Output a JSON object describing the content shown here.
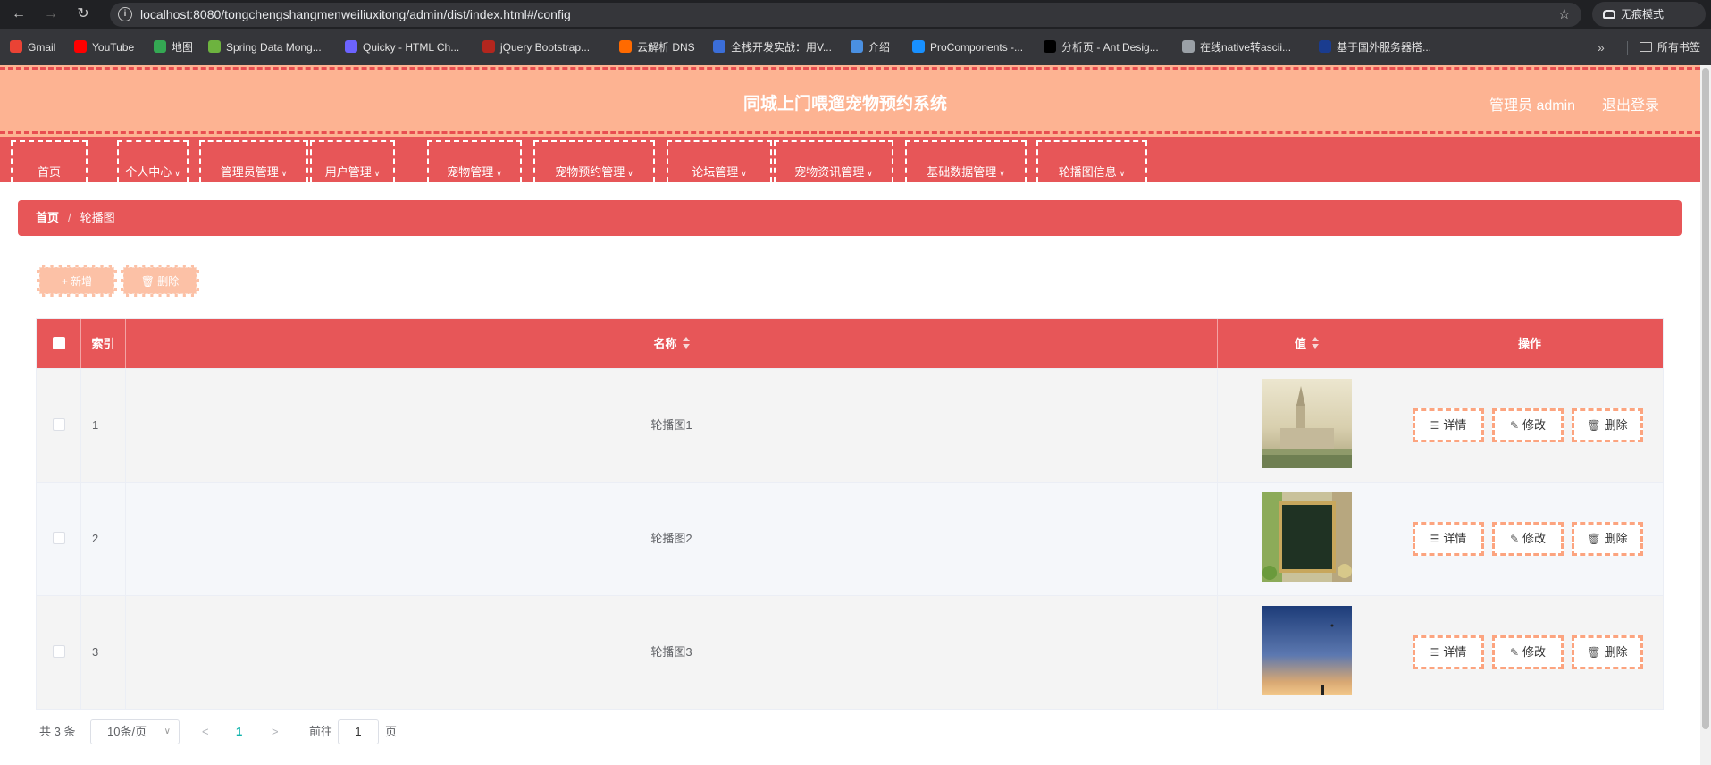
{
  "browser": {
    "url": "localhost:8080/tongchengshangmenweiliuxitong/admin/dist/index.html#/config",
    "incognito_label": "无痕模式",
    "bookmarks": [
      {
        "label": "Gmail",
        "color": "#ea4335"
      },
      {
        "label": "YouTube",
        "color": "#ff0000"
      },
      {
        "label": "地图",
        "color": "#34a853"
      },
      {
        "label": "Spring Data Mong...",
        "color": "#6db33f"
      },
      {
        "label": "Quicky - HTML Ch...",
        "color": "#6c63ff"
      },
      {
        "label": "jQuery Bootstrap...",
        "color": "#b3261e"
      },
      {
        "label": "云解析 DNS",
        "color": "#ff6a00"
      },
      {
        "label": "全栈开发实战：用V...",
        "color": "#3b6ed8"
      },
      {
        "label": "介绍",
        "color": "#4a90e2"
      },
      {
        "label": "ProComponents -...",
        "color": "#1890ff"
      },
      {
        "label": "分析页 - Ant Desig...",
        "color": "#000000"
      },
      {
        "label": "在线native转ascii...",
        "color": "#9aa0a6"
      },
      {
        "label": "基于国外服务器搭...",
        "color": "#1a3c8f"
      }
    ],
    "all_bookmarks_label": "所有书签"
  },
  "header": {
    "title": "同城上门喂遛宠物预约系统",
    "user_label": "管理员 admin",
    "logout_label": "退出登录"
  },
  "menu": [
    {
      "label": "首页",
      "dropdown": false
    },
    {
      "label": "个人中心",
      "dropdown": true
    },
    {
      "label": "管理员管理",
      "dropdown": true
    },
    {
      "label": "用户管理",
      "dropdown": true
    },
    {
      "label": "宠物管理",
      "dropdown": true
    },
    {
      "label": "宠物预约管理",
      "dropdown": true
    },
    {
      "label": "论坛管理",
      "dropdown": true
    },
    {
      "label": "宠物资讯管理",
      "dropdown": true
    },
    {
      "label": "基础数据管理",
      "dropdown": true
    },
    {
      "label": "轮播图信息",
      "dropdown": true
    }
  ],
  "breadcrumb": {
    "home": "首页",
    "separator": "/",
    "current": "轮播图"
  },
  "actions": {
    "add_label": "新增",
    "delete_label": "删除"
  },
  "table": {
    "headers": {
      "index": "索引",
      "name": "名称",
      "value": "值",
      "ops": "操作"
    },
    "rows": [
      {
        "index": "1",
        "name": "轮播图1",
        "image": "city"
      },
      {
        "index": "2",
        "name": "轮播图2",
        "image": "board"
      },
      {
        "index": "3",
        "name": "轮播图3",
        "image": "sky"
      }
    ],
    "row_buttons": {
      "detail": "详情",
      "edit": "修改",
      "delete": "删除"
    }
  },
  "pagination": {
    "total_text": "共 3 条",
    "page_size": "10条/页",
    "current_page": "1",
    "goto_label": "前往",
    "goto_value": "1",
    "page_suffix": "页"
  },
  "colors": {
    "header_bg": "#fdb392",
    "accent_red": "#e75658",
    "button_border": "#fca47f"
  }
}
